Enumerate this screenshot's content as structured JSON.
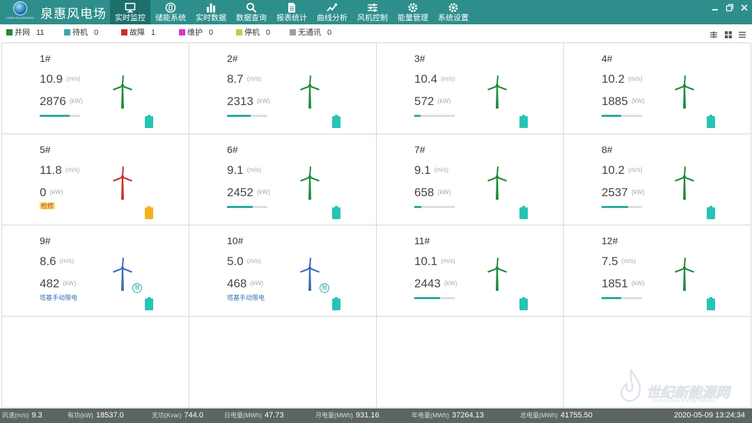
{
  "app": {
    "title": "泉惠风电场",
    "logo_text": "CHINA GUANGDONG"
  },
  "nav": [
    {
      "label": "实时监控",
      "icon": "monitor-icon",
      "active": true
    },
    {
      "label": "储能系统",
      "icon": "storage-icon",
      "active": false
    },
    {
      "label": "实时数据",
      "icon": "bar-chart-icon",
      "active": false
    },
    {
      "label": "数据查询",
      "icon": "search-icon",
      "active": false
    },
    {
      "label": "报表统计",
      "icon": "report-icon",
      "active": false
    },
    {
      "label": "曲线分析",
      "icon": "trend-icon",
      "active": false
    },
    {
      "label": "风机控制",
      "icon": "sliders-icon",
      "active": false
    },
    {
      "label": "能量管理",
      "icon": "gear-icon",
      "active": false
    },
    {
      "label": "系统设置",
      "icon": "settings-icon",
      "active": false
    }
  ],
  "legend": [
    {
      "label": "并网",
      "count": "11",
      "color": "#1e8a3a"
    },
    {
      "label": "待机",
      "count": "0",
      "color": "#3aa9a4"
    },
    {
      "label": "故障",
      "count": "1",
      "color": "#c9302c"
    },
    {
      "label": "维护",
      "count": "0",
      "color": "#d633d6"
    },
    {
      "label": "停机",
      "count": "0",
      "color": "#b5d33d"
    },
    {
      "label": "无通讯",
      "count": "0",
      "color": "#9aa0a6"
    }
  ],
  "units": {
    "wind": "(m/s)",
    "power": "(kW)"
  },
  "turbines": [
    {
      "name": "1#",
      "wind": "10.9",
      "power": "2876",
      "progress": 0.74,
      "state": "grid",
      "color": "#1e8a3a",
      "status_text": "",
      "status_kind": "",
      "limit": false,
      "battery_color": "#27c3b5"
    },
    {
      "name": "2#",
      "wind": "8.7",
      "power": "2313",
      "progress": 0.59,
      "state": "grid",
      "color": "#1e8a3a",
      "status_text": "",
      "status_kind": "",
      "limit": false,
      "battery_color": "#27c3b5"
    },
    {
      "name": "3#",
      "wind": "10.4",
      "power": "572",
      "progress": 0.15,
      "state": "grid",
      "color": "#1e8a3a",
      "status_text": "",
      "status_kind": "",
      "limit": false,
      "battery_color": "#27c3b5"
    },
    {
      "name": "4#",
      "wind": "10.2",
      "power": "1885",
      "progress": 0.49,
      "state": "grid",
      "color": "#1e8a3a",
      "status_text": "",
      "status_kind": "",
      "limit": false,
      "battery_color": "#27c3b5"
    },
    {
      "name": "5#",
      "wind": "11.8",
      "power": "0",
      "progress": 0,
      "state": "fault",
      "color": "#c9302c",
      "status_text": "检修",
      "status_kind": "repair",
      "limit": false,
      "battery_color": "#f2b21b"
    },
    {
      "name": "6#",
      "wind": "9.1",
      "power": "2452",
      "progress": 0.63,
      "state": "grid",
      "color": "#1e8a3a",
      "status_text": "",
      "status_kind": "",
      "limit": false,
      "battery_color": "#27c3b5"
    },
    {
      "name": "7#",
      "wind": "9.1",
      "power": "658",
      "progress": 0.17,
      "state": "grid",
      "color": "#1e8a3a",
      "status_text": "",
      "status_kind": "",
      "limit": false,
      "battery_color": "#27c3b5"
    },
    {
      "name": "8#",
      "wind": "10.2",
      "power": "2537",
      "progress": 0.66,
      "state": "grid",
      "color": "#1e8a3a",
      "status_text": "",
      "status_kind": "",
      "limit": false,
      "battery_color": "#27c3b5"
    },
    {
      "name": "9#",
      "wind": "8.6",
      "power": "482",
      "progress": 0,
      "state": "limited",
      "color": "#3b6cb8",
      "status_text": "塔基手动限电",
      "status_kind": "limit",
      "limit": true,
      "battery_color": "#27c3b5"
    },
    {
      "name": "10#",
      "wind": "5.0",
      "power": "468",
      "progress": 0,
      "state": "limited",
      "color": "#3b6cb8",
      "status_text": "塔基手动限电",
      "status_kind": "limit",
      "limit": true,
      "battery_color": "#27c3b5"
    },
    {
      "name": "11#",
      "wind": "10.1",
      "power": "2443",
      "progress": 0.63,
      "state": "grid",
      "color": "#1e8a3a",
      "status_text": "",
      "status_kind": "",
      "limit": false,
      "battery_color": "#27c3b5"
    },
    {
      "name": "12#",
      "wind": "7.5",
      "power": "1851",
      "progress": 0.48,
      "state": "grid",
      "color": "#1e8a3a",
      "status_text": "",
      "status_kind": "",
      "limit": false,
      "battery_color": "#27c3b5"
    }
  ],
  "limit_badge": "限",
  "bottom": [
    {
      "label": "风速(m/s)",
      "value": "9.3"
    },
    {
      "label": "有功(kW)",
      "value": "18537.0"
    },
    {
      "label": "无功(Kvar)",
      "value": "744.0"
    },
    {
      "label": "日电量(MWh)",
      "value": "47.73"
    },
    {
      "label": "月电量(MWh)",
      "value": "931.16"
    },
    {
      "label": "年电量(MWh)",
      "value": "37264.13"
    },
    {
      "label": "总电量(MWh)",
      "value": "41755.50"
    }
  ],
  "datetime": "2020-05-09 13:24:34",
  "watermark": {
    "text": "世纪新能源网",
    "sub": "Century New Energy Network"
  }
}
